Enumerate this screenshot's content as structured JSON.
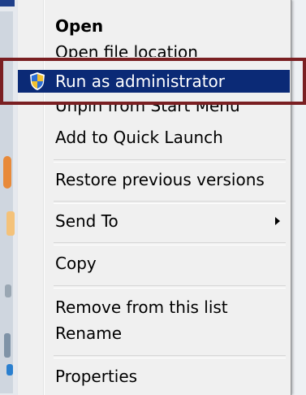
{
  "menu": {
    "items": [
      {
        "label": "Open",
        "bold": true
      },
      {
        "label": "Open file location"
      },
      {
        "label": "Run as administrator",
        "selected": true,
        "icon": "uac-shield-icon"
      },
      {
        "label": "Unpin from Start Menu"
      },
      {
        "label": "Add to Quick Launch"
      },
      {
        "label": "Restore previous versions"
      },
      {
        "label": "Send To",
        "submenu": true
      },
      {
        "label": "Copy"
      },
      {
        "label": "Remove from this list"
      },
      {
        "label": "Rename"
      },
      {
        "label": "Properties"
      }
    ]
  },
  "colors": {
    "selection": "#0b2a76",
    "annotation_border": "#7a1f22",
    "menu_background": "#f0f0f0"
  }
}
